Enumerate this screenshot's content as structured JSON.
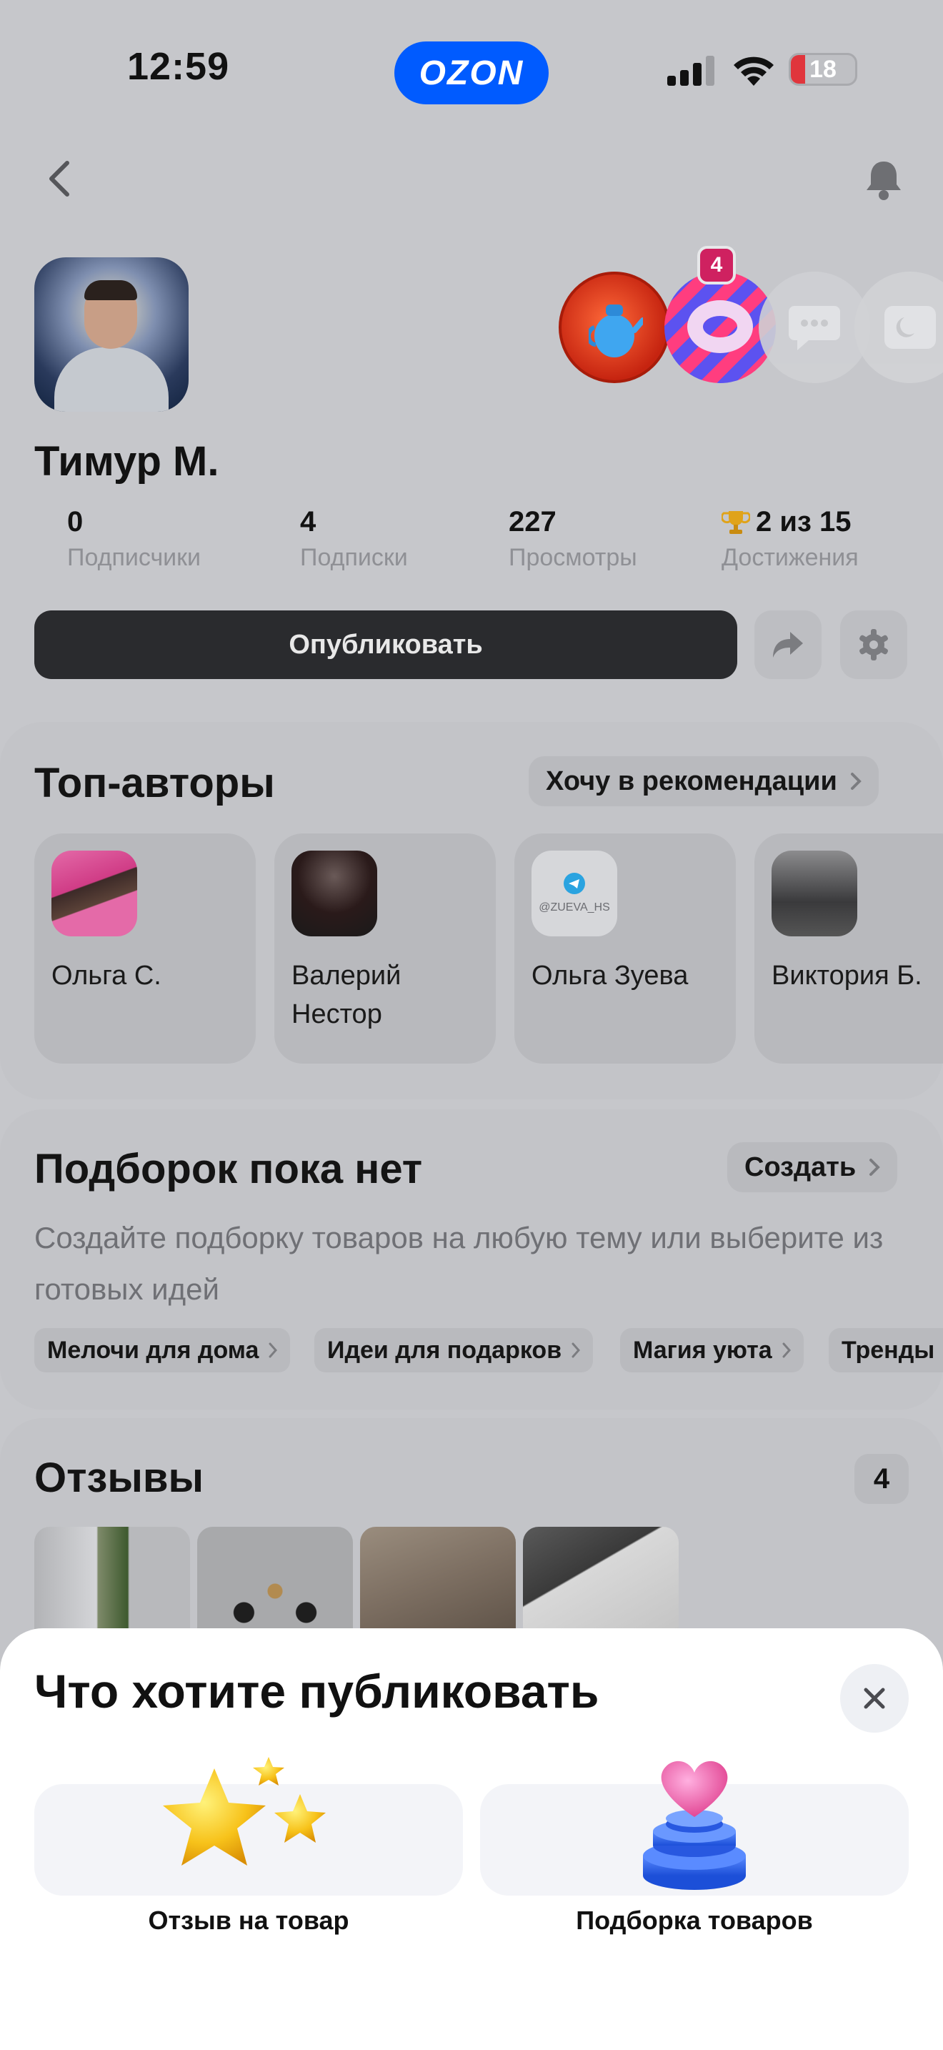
{
  "status_bar": {
    "time": "12:59",
    "app_badge": "OZON",
    "battery_level": "18"
  },
  "profile": {
    "name": "Тимур М.",
    "achievements_new_count": "4",
    "stats": [
      {
        "value": "0",
        "label": "Подписчики"
      },
      {
        "value": "4",
        "label": "Подписки"
      },
      {
        "value": "227",
        "label": "Просмотры"
      },
      {
        "value": "2 из 15",
        "label": "Достижения"
      }
    ],
    "publish_label": "Опубликовать"
  },
  "top_authors": {
    "title": "Топ-авторы",
    "link": "Хочу в рекомендации",
    "authors": [
      {
        "name": "Ольга С."
      },
      {
        "name": "Валерий Нестор"
      },
      {
        "name": "Ольга Зуева",
        "avatar_text": "@ZUEVA_HS"
      },
      {
        "name": "Виктория Б."
      }
    ]
  },
  "collections": {
    "title": "Подборок пока нет",
    "create_label": "Создать",
    "description": "Создайте подборку товаров на любую тему или выберите из готовых идей",
    "tags": [
      "Мелочи для дома",
      "Идеи для подарков",
      "Магия уюта",
      "Тренды"
    ]
  },
  "reviews": {
    "title": "Отзывы",
    "count": "4"
  },
  "sheet": {
    "title": "Что хотите публиковать",
    "options": [
      {
        "label": "Отзыв на товар",
        "icon": "stars-icon"
      },
      {
        "label": "Подборка товаров",
        "icon": "heart-stack-icon"
      }
    ]
  },
  "colors": {
    "accent": "#005bff",
    "badge": "#cf2160",
    "dark_button": "#2a2b2e"
  }
}
